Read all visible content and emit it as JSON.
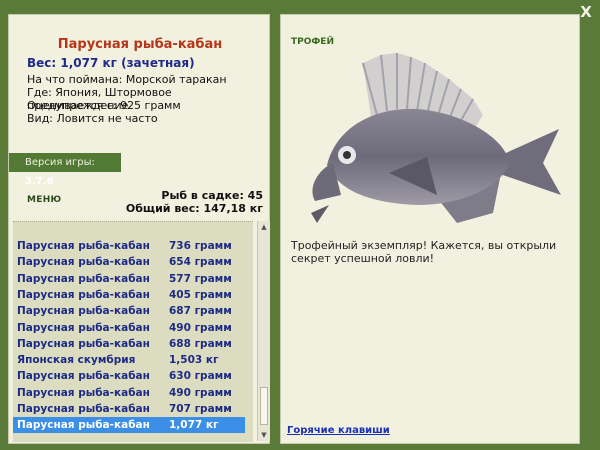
{
  "window": {
    "close_label": "X"
  },
  "fish": {
    "title": "Парусная рыба-кабан",
    "weight": "Вес: 1,077 кг (зачетная)",
    "info": [
      "На что поймана: Морской таракан",
      "Где: Япония, Штормовое предупреждение",
      "Оценивается с: 925 грамм",
      "Вид: Ловится не часто"
    ]
  },
  "version": {
    "label": "Версия игры:",
    "value": "3.7.6"
  },
  "menu_label": "МЕНЮ",
  "stats": {
    "in_cage": "Рыб в садке: 45",
    "total_weight": "Общий вес: 147,18 кг"
  },
  "catch_list": [
    {
      "name": "Парусная рыба-кабан",
      "weight": "736 грамм"
    },
    {
      "name": "Парусная рыба-кабан",
      "weight": "654 грамм"
    },
    {
      "name": "Парусная рыба-кабан",
      "weight": "577 грамм"
    },
    {
      "name": "Парусная рыба-кабан",
      "weight": "405 грамм"
    },
    {
      "name": "Парусная рыба-кабан",
      "weight": "687 грамм"
    },
    {
      "name": "Парусная рыба-кабан",
      "weight": "490 грамм"
    },
    {
      "name": "Парусная рыба-кабан",
      "weight": "688 грамм"
    },
    {
      "name": "Японская скумбрия",
      "weight": "1,503 кг"
    },
    {
      "name": "Парусная рыба-кабан",
      "weight": "630 грамм"
    },
    {
      "name": "Парусная рыба-кабан",
      "weight": "490 грамм"
    },
    {
      "name": "Парусная рыба-кабан",
      "weight": "707 грамм"
    },
    {
      "name": "Парусная рыба-кабан",
      "weight": "1,077 кг",
      "selected": true
    }
  ],
  "trophy": {
    "label": "ТРОФЕЙ",
    "description": "Трофейный экземпляр! Кажется, вы открыли секрет успешной ловли!"
  },
  "hotkeys_label": "Горячие клавиши",
  "colors": {
    "background": "#5a7a3a",
    "panel": "#f2f1df",
    "title": "#b5361b",
    "list_text": "#1d2a86",
    "selected_row": "#3b8fe6"
  }
}
